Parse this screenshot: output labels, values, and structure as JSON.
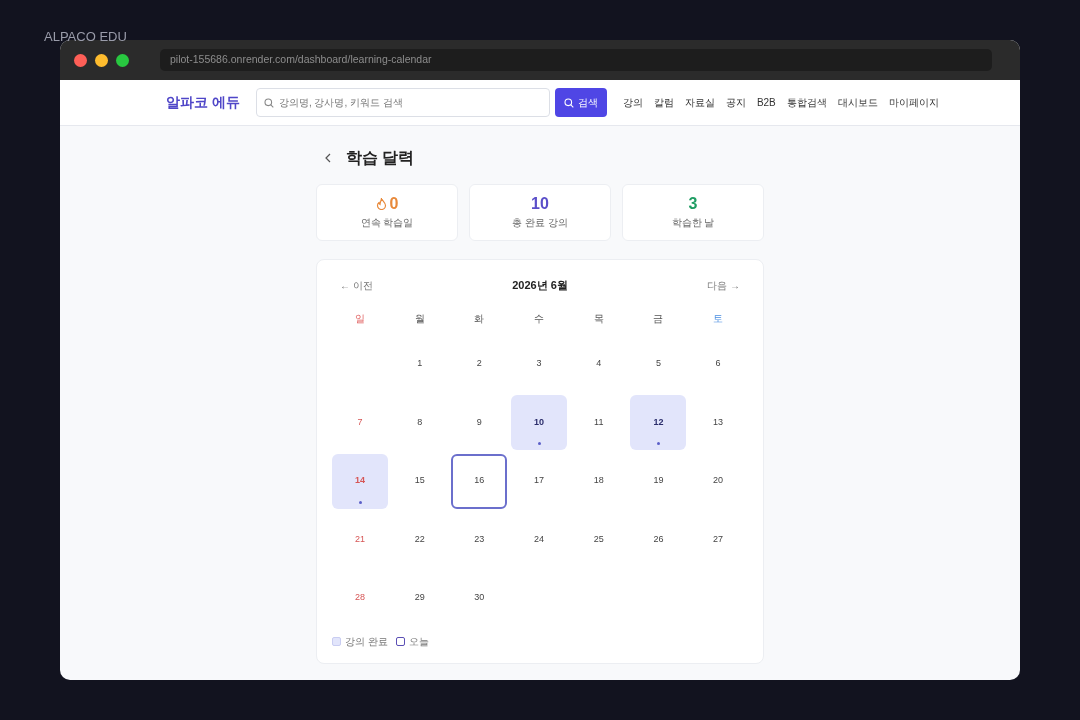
{
  "brand_label": "ALPACO EDU",
  "window": {
    "url": "pilot-155686.onrender.com/dashboard/learning-calendar"
  },
  "navbar": {
    "logo": "알파코 에듀",
    "search": {
      "placeholder": "강의명, 강사명, 키워드 검색"
    },
    "search_button": "검색",
    "links": [
      "강의",
      "칼럼",
      "자료실",
      "공지",
      "B2B",
      "통합검색",
      "대시보드",
      "마이페이지"
    ]
  },
  "page_title": "학습 달력",
  "stats": [
    {
      "value": "0",
      "label": "연속 학습일",
      "color": "#e8893a",
      "kind": "streak"
    },
    {
      "value": "10",
      "label": "총 완료 강의",
      "color": "#5b4fc9",
      "kind": "plain"
    },
    {
      "value": "3",
      "label": "학습한 날",
      "color": "#1f9d63",
      "kind": "plain"
    }
  ],
  "calendar": {
    "prev": "← 이전",
    "title": "2026년 6월",
    "next": "다음 →",
    "weekdays": [
      "일",
      "월",
      "화",
      "수",
      "목",
      "금",
      "토"
    ],
    "weeks": [
      {
        "days": [
          {
            "kind": "blank"
          },
          {
            "kind": "date",
            "label": "1",
            "completed": false,
            "today": false
          },
          {
            "kind": "date",
            "label": "2",
            "completed": false,
            "today": false
          },
          {
            "kind": "date",
            "label": "3",
            "completed": false,
            "today": false
          },
          {
            "kind": "date",
            "label": "4",
            "completed": false,
            "today": false
          },
          {
            "kind": "date",
            "label": "5",
            "completed": false,
            "today": false
          },
          {
            "kind": "date",
            "label": "6",
            "completed": false,
            "today": false
          }
        ]
      },
      {
        "days": [
          {
            "kind": "date",
            "label": "7",
            "completed": false,
            "today": false
          },
          {
            "kind": "date",
            "label": "8",
            "completed": false,
            "today": false
          },
          {
            "kind": "date",
            "label": "9",
            "completed": false,
            "today": false
          },
          {
            "kind": "date",
            "label": "10",
            "completed": true,
            "today": false
          },
          {
            "kind": "date",
            "label": "11",
            "completed": false,
            "today": false
          },
          {
            "kind": "date",
            "label": "12",
            "completed": true,
            "today": false
          },
          {
            "kind": "date",
            "label": "13",
            "completed": false,
            "today": false
          }
        ]
      },
      {
        "days": [
          {
            "kind": "date",
            "label": "14",
            "completed": true,
            "today": false
          },
          {
            "kind": "date",
            "label": "15",
            "completed": false,
            "today": false
          },
          {
            "kind": "date",
            "label": "16",
            "completed": false,
            "today": true
          },
          {
            "kind": "date",
            "label": "17",
            "completed": false,
            "today": false
          },
          {
            "kind": "date",
            "label": "18",
            "completed": false,
            "today": false
          },
          {
            "kind": "date",
            "label": "19",
            "completed": false,
            "today": false
          },
          {
            "kind": "date",
            "label": "20",
            "completed": false,
            "today": false
          }
        ]
      },
      {
        "days": [
          {
            "kind": "date",
            "label": "21",
            "completed": false,
            "today": false
          },
          {
            "kind": "date",
            "label": "22",
            "completed": false,
            "today": false
          },
          {
            "kind": "date",
            "label": "23",
            "completed": false,
            "today": false
          },
          {
            "kind": "date",
            "label": "24",
            "completed": false,
            "today": false
          },
          {
            "kind": "date",
            "label": "25",
            "completed": false,
            "today": false
          },
          {
            "kind": "date",
            "label": "26",
            "completed": false,
            "today": false
          },
          {
            "kind": "date",
            "label": "27",
            "completed": false,
            "today": false
          }
        ]
      },
      {
        "days": [
          {
            "kind": "date",
            "label": "28",
            "completed": false,
            "today": false
          },
          {
            "kind": "date",
            "label": "29",
            "completed": false,
            "today": false
          },
          {
            "kind": "date",
            "label": "30",
            "completed": false,
            "today": false
          }
        ]
      }
    ],
    "legend": [
      {
        "kind": "completed",
        "label": "강의 완료"
      },
      {
        "kind": "today",
        "label": "오늘"
      }
    ]
  }
}
